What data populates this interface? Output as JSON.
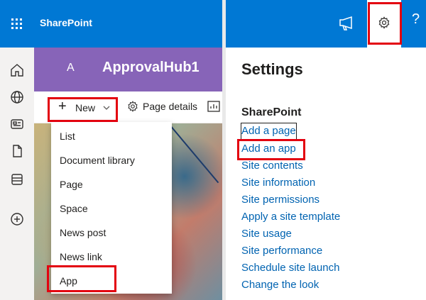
{
  "suite": {
    "title": "SharePoint"
  },
  "site": {
    "initial": "A",
    "title": "ApprovalHub1"
  },
  "command_bar": {
    "new_label": "New",
    "page_details_label": "Page details"
  },
  "new_menu": {
    "items": [
      "List",
      "Document library",
      "Page",
      "Space",
      "News post",
      "News link",
      "App"
    ]
  },
  "settings_panel": {
    "title": "Settings",
    "section_heading": "SharePoint",
    "links": [
      "Add a page",
      "Add an app",
      "Site contents",
      "Site information",
      "Site permissions",
      "Apply a site template",
      "Site usage",
      "Site performance",
      "Schedule site launch",
      "Change the look"
    ]
  },
  "header_right": {
    "help_label": "?"
  },
  "colors": {
    "suite_blue": "#0078d4",
    "site_purple": "#8764b8",
    "link_blue": "#0063b1",
    "highlight_red": "#e3000f"
  }
}
